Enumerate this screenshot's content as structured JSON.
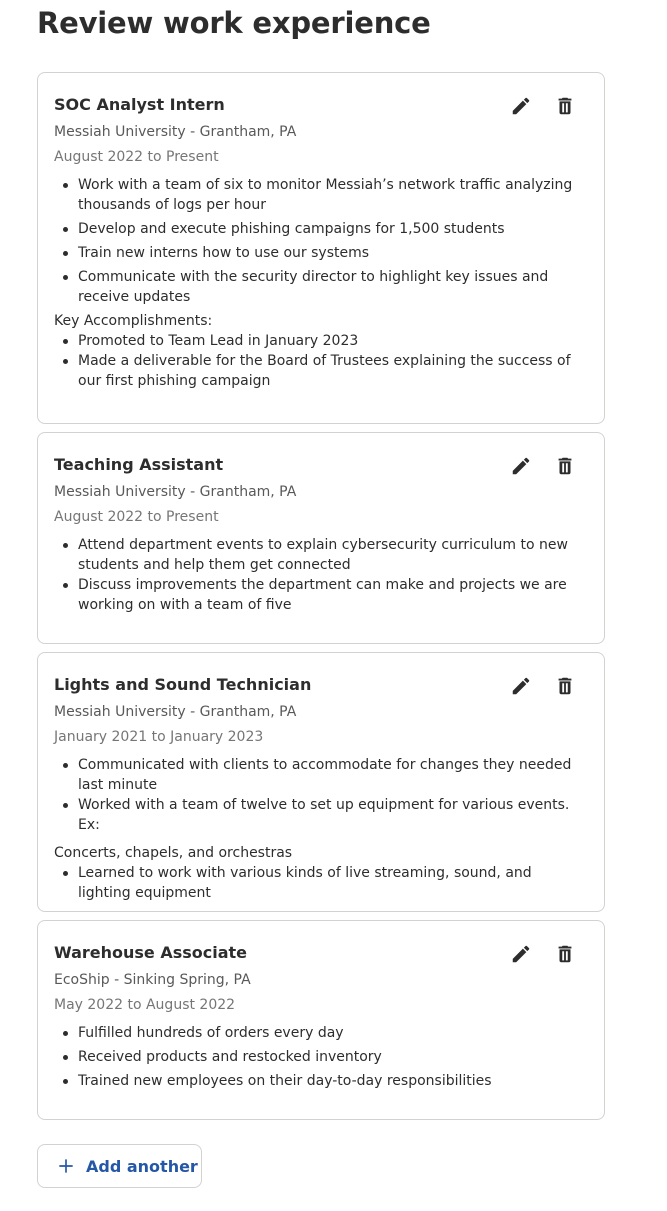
{
  "page": {
    "title": "Review work experience"
  },
  "jobs": [
    {
      "title": "SOC Analyst Intern",
      "company": "Messiah University - Grantham, PA",
      "dates": "August 2022 to Present",
      "bullets": [
        "Work with a team of six to monitor Messiah’s network traffic analyzing thousands of logs per hour",
        "Develop and execute phishing campaigns for 1,500 students",
        "Train new interns how to use our systems",
        "Communicate with the security director to highlight key issues and receive updates"
      ],
      "section_label": "Key Accomplishments:",
      "bullets2": [
        "Promoted to Team Lead in January 2023",
        "Made a deliverable for the Board of Trustees explaining the success of our first phishing campaign"
      ]
    },
    {
      "title": "Teaching Assistant",
      "company": "Messiah University - Grantham, PA",
      "dates": "August 2022 to Present",
      "bullets": [
        "Attend department events to explain cybersecurity curriculum to new students and help them get connected",
        "Discuss improvements the department can make and projects we are working on with a team of five"
      ]
    },
    {
      "title": "Lights and Sound Technician",
      "company": "Messiah University - Grantham, PA",
      "dates": "January 2021 to January 2023",
      "bullets": [
        "Communicated with clients to accommodate for changes they needed last minute",
        "Worked with a team of twelve to set up equipment for various events. Ex:"
      ],
      "section_label": "Concerts, chapels, and orchestras",
      "bullets2": [
        "Learned to work with various kinds of live streaming, sound, and lighting equipment"
      ]
    },
    {
      "title": "Warehouse Associate",
      "company": "EcoShip - Sinking Spring, PA",
      "dates": "May 2022 to August 2022",
      "bullets": [
        "Fulfilled hundreds of orders every day",
        "Received products and restocked inventory",
        "Trained new employees on their day-to-day responsibilities"
      ]
    }
  ],
  "actions": {
    "add_another_label": "Add another"
  },
  "icons": {
    "edit": "pencil-icon",
    "delete": "trash-icon",
    "add": "plus-icon"
  },
  "colors": {
    "accent": "#2557a7",
    "text": "#2d2d2d",
    "border": "#d4d2d0"
  }
}
